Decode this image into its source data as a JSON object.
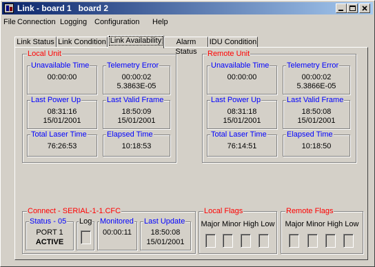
{
  "window": {
    "title": "Link - board 1   board 2"
  },
  "menu": [
    "File",
    "Connection",
    "Logging",
    "Configuration",
    "Help"
  ],
  "tabs": [
    "Link Status",
    "Link Condition",
    "Link Availability",
    "Alarm Status",
    "IDU Condition"
  ],
  "active_tab": "Link Availability",
  "local": {
    "title": "Local Unit",
    "unavailable_time": {
      "label": "Unavailable Time",
      "value": "00:00:00"
    },
    "telemetry_error": {
      "label": "Telemetry Error",
      "value1": "00:00:02",
      "value2": "5.3863E-05"
    },
    "last_power_up": {
      "label": "Last Power Up",
      "time": "08:31:16",
      "date": "15/01/2001"
    },
    "last_valid_frame": {
      "label": "Last Valid Frame",
      "time": "18:50:09",
      "date": "15/01/2001"
    },
    "total_laser_time": {
      "label": "Total Laser Time",
      "value": "76:26:53"
    },
    "elapsed_time": {
      "label": "Elapsed Time",
      "value": "10:18:53"
    }
  },
  "remote": {
    "title": "Remote Unit",
    "unavailable_time": {
      "label": "Unavailable Time",
      "value": "00:00:00"
    },
    "telemetry_error": {
      "label": "Telemetry Error",
      "value1": "00:00:02",
      "value2": "5.3866E-05"
    },
    "last_power_up": {
      "label": "Last Power Up",
      "time": "08:31:18",
      "date": "15/01/2001"
    },
    "last_valid_frame": {
      "label": "Last Valid Frame",
      "time": "18:50:08",
      "date": "15/01/2001"
    },
    "total_laser_time": {
      "label": "Total Laser Time",
      "value": "76:14:51"
    },
    "elapsed_time": {
      "label": "Elapsed Time",
      "value": "10:18:50"
    }
  },
  "connect": {
    "title": "Connect - SERIAL-1-1.CFC",
    "status": {
      "label": "Status - 05",
      "port": "PORT 1",
      "state": "ACTIVE"
    },
    "log": {
      "label": "Log"
    },
    "monitored": {
      "label": "Monitored",
      "value": "00:00:11"
    },
    "last_update": {
      "label": "Last Update",
      "time": "18:50:08",
      "date": "15/01/2001"
    }
  },
  "local_flags": {
    "title": "Local Flags",
    "labels": "Major Minor High Low"
  },
  "remote_flags": {
    "title": "Remote Flags",
    "labels": "Major Minor High Low"
  },
  "colors": {
    "title_bar": "#0a246a",
    "group_title": "#ff0000",
    "field_label": "#0000ff",
    "face": "#d4d0c8"
  }
}
